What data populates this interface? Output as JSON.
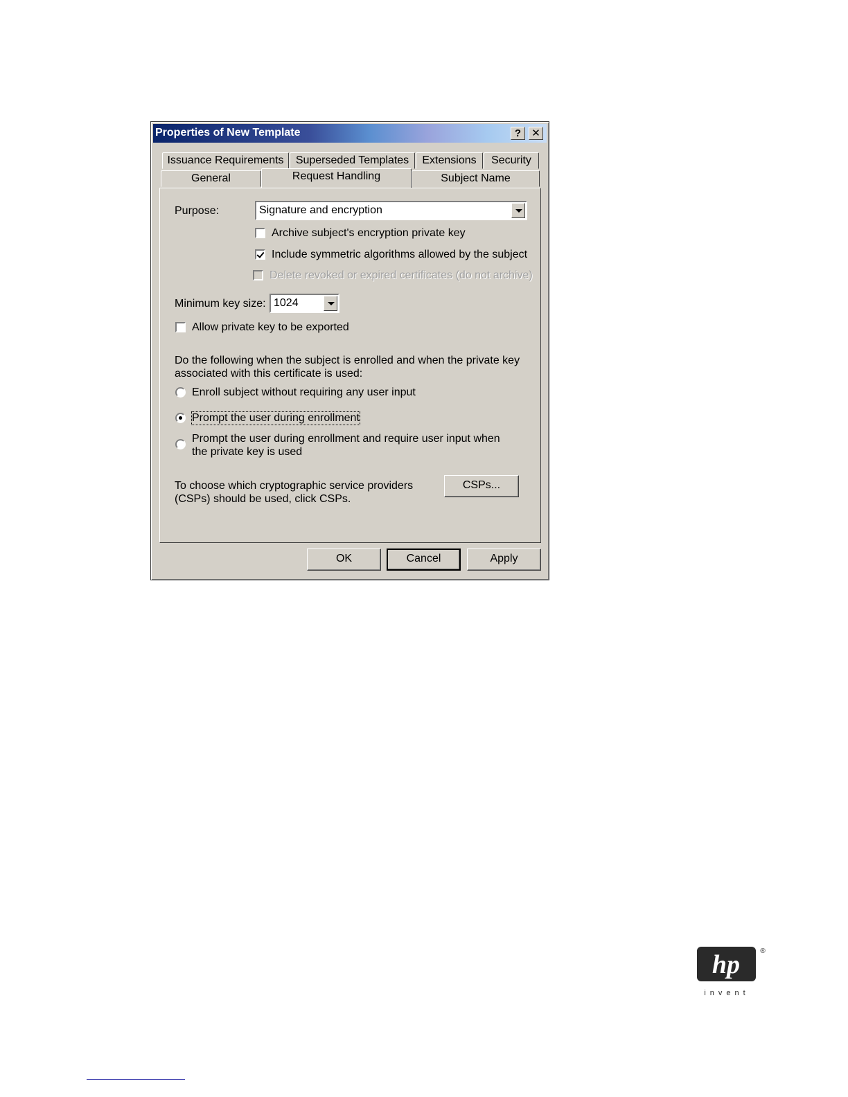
{
  "window": {
    "title": "Properties of New Template",
    "help_button": "?",
    "close_button": "✕"
  },
  "tabs_row1": [
    {
      "label": "Issuance Requirements"
    },
    {
      "label": "Superseded Templates"
    },
    {
      "label": "Extensions"
    },
    {
      "label": "Security"
    }
  ],
  "tabs_row2": [
    {
      "label": "General"
    },
    {
      "label": "Request Handling",
      "active": true
    },
    {
      "label": "Subject Name"
    }
  ],
  "purpose": {
    "label": "Purpose:",
    "value": "Signature and encryption"
  },
  "checkboxes": {
    "archive": {
      "label": "Archive subject's encryption private key",
      "checked": false,
      "enabled": true
    },
    "include_symmetric": {
      "label": "Include symmetric algorithms allowed by the subject",
      "checked": true,
      "enabled": true
    },
    "delete_revoked": {
      "label": "Delete revoked or expired certificates (do not archive)",
      "checked": false,
      "enabled": false
    },
    "allow_export": {
      "label": "Allow private key to be exported",
      "checked": false,
      "enabled": true
    }
  },
  "min_key_size": {
    "label": "Minimum key size:",
    "value": "1024"
  },
  "enrollment": {
    "description": "Do the following when the subject is enrolled and when the private key associated with this certificate is used:",
    "options": [
      {
        "label": "Enroll subject without requiring any user input",
        "selected": false
      },
      {
        "label": "Prompt the user during enrollment",
        "selected": true
      },
      {
        "label": "Prompt the user during enrollment and require user input when the private key is used",
        "selected": false
      }
    ]
  },
  "csp": {
    "description": "To choose which cryptographic service providers (CSPs) should be used, click CSPs.",
    "button": "CSPs..."
  },
  "buttons": {
    "ok": "OK",
    "cancel": "Cancel",
    "apply": "Apply"
  },
  "logo": {
    "mark": "hp",
    "tagline": "invent",
    "registered": "®"
  }
}
